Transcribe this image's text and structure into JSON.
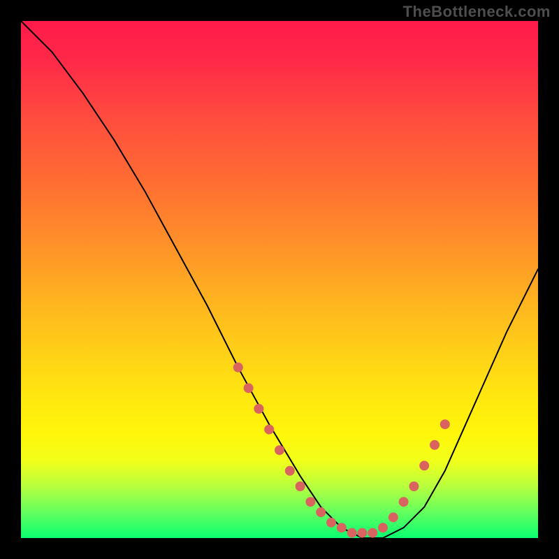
{
  "watermark": "TheBottleneck.com",
  "chart_data": {
    "type": "line",
    "title": "",
    "xlabel": "",
    "ylabel": "",
    "xlim": [
      0,
      100
    ],
    "ylim": [
      0,
      100
    ],
    "grid": false,
    "legend": false,
    "background_gradient": {
      "direction": "vertical",
      "stops": [
        {
          "pos": 0,
          "color": "#ff1a4a"
        },
        {
          "pos": 40,
          "color": "#ff8d2a"
        },
        {
          "pos": 75,
          "color": "#fff60a"
        },
        {
          "pos": 100,
          "color": "#0aff71"
        }
      ]
    },
    "series": [
      {
        "name": "bottleneck-curve",
        "x": [
          0,
          6,
          12,
          18,
          24,
          30,
          36,
          42,
          48,
          54,
          58,
          62,
          66,
          70,
          74,
          78,
          82,
          86,
          90,
          94,
          98,
          100
        ],
        "y": [
          100,
          94,
          86,
          77,
          67,
          56,
          45,
          33,
          22,
          12,
          6,
          2,
          0,
          0,
          2,
          6,
          13,
          22,
          31,
          40,
          48,
          52
        ]
      }
    ],
    "scatter": {
      "name": "highlight-dots",
      "color": "#d9635f",
      "points": [
        {
          "x": 42,
          "y": 33
        },
        {
          "x": 44,
          "y": 29
        },
        {
          "x": 46,
          "y": 25
        },
        {
          "x": 48,
          "y": 21
        },
        {
          "x": 50,
          "y": 17
        },
        {
          "x": 52,
          "y": 13
        },
        {
          "x": 54,
          "y": 10
        },
        {
          "x": 56,
          "y": 7
        },
        {
          "x": 58,
          "y": 5
        },
        {
          "x": 60,
          "y": 3
        },
        {
          "x": 62,
          "y": 2
        },
        {
          "x": 64,
          "y": 1
        },
        {
          "x": 66,
          "y": 1
        },
        {
          "x": 68,
          "y": 1
        },
        {
          "x": 70,
          "y": 2
        },
        {
          "x": 72,
          "y": 4
        },
        {
          "x": 74,
          "y": 7
        },
        {
          "x": 76,
          "y": 10
        },
        {
          "x": 78,
          "y": 14
        },
        {
          "x": 80,
          "y": 18
        },
        {
          "x": 82,
          "y": 22
        }
      ]
    }
  }
}
